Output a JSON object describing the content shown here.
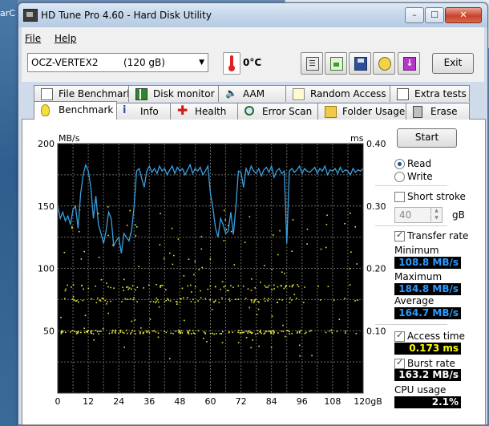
{
  "desktop": {
    "left_text": "arC"
  },
  "window": {
    "title": "HD Tune Pro 4.60 - Hard Disk Utility",
    "controls": {
      "minimize": "–",
      "maximize": "☐",
      "close": "✕"
    }
  },
  "menu": {
    "file": "File",
    "help": "Help"
  },
  "toolbar": {
    "drive_name": "OCZ-VERTEX2",
    "drive_size": "(120 gB)",
    "temperature": "0°C",
    "exit_label": "Exit",
    "icons": [
      "copy-text-icon",
      "copy-screenshot-icon",
      "save-icon",
      "options-icon",
      "download-icon"
    ]
  },
  "tabs_top": [
    {
      "label": "File Benchmark",
      "icon": "file-benchmark-icon"
    },
    {
      "label": "Disk monitor",
      "icon": "disk-monitor-icon"
    },
    {
      "label": "AAM",
      "icon": "speaker-icon"
    },
    {
      "label": "Random Access",
      "icon": "random-access-icon"
    },
    {
      "label": "Extra tests",
      "icon": "extra-tests-icon"
    }
  ],
  "tabs_bottom": [
    {
      "label": "Benchmark",
      "icon": "bulb-icon",
      "active": true
    },
    {
      "label": "Info",
      "icon": "info-icon"
    },
    {
      "label": "Health",
      "icon": "health-cross-icon"
    },
    {
      "label": "Error Scan",
      "icon": "magnifier-icon"
    },
    {
      "label": "Folder Usage",
      "icon": "folder-icon"
    },
    {
      "label": "Erase",
      "icon": "trash-icon"
    }
  ],
  "chart_data": {
    "type": "line",
    "y_left_label": "MB/s",
    "y_right_label": "ms",
    "y_left_ticks": [
      "200",
      "150",
      "100",
      "50"
    ],
    "y_right_ticks": [
      "0.40",
      "0.30",
      "0.20",
      "0.10"
    ],
    "x_ticks": [
      "0",
      "12",
      "24",
      "36",
      "48",
      "60",
      "72",
      "84",
      "96",
      "108",
      "120gB"
    ],
    "ylim_left": [
      0,
      200
    ],
    "ylim_right": [
      0,
      0.4
    ],
    "xlim": [
      0,
      120
    ],
    "grid": true,
    "series": [
      {
        "color": "#3aa0e0",
        "x": [
          0,
          1,
          2,
          3,
          4,
          5,
          6,
          7,
          8,
          9,
          10,
          11,
          12,
          13,
          14,
          15,
          16,
          17,
          18,
          19,
          20,
          21,
          22,
          23,
          24,
          25,
          26,
          27,
          28,
          29,
          30,
          31,
          32,
          33,
          34,
          35,
          36,
          37,
          38,
          39,
          40,
          41,
          42,
          43,
          44,
          45,
          46,
          47,
          48,
          49,
          50,
          51,
          52,
          53,
          54,
          55,
          56,
          57,
          58,
          59,
          60,
          61,
          62,
          63,
          64,
          65,
          66,
          67,
          68,
          69,
          70,
          71,
          72,
          73,
          74,
          75,
          76,
          77,
          78,
          79,
          80,
          81,
          82,
          83,
          84,
          85,
          86,
          87,
          88,
          89,
          90,
          91,
          92,
          93,
          94,
          95,
          96,
          97,
          98,
          99,
          100,
          101,
          102,
          103,
          104,
          105,
          106,
          107,
          108,
          109,
          110,
          111,
          112,
          113,
          114,
          115,
          116,
          117,
          118,
          119,
          120
        ],
        "values": [
          150,
          140,
          145,
          138,
          142,
          135,
          147,
          150,
          132,
          160,
          175,
          183,
          178,
          165,
          140,
          158,
          135,
          128,
          120,
          130,
          145,
          140,
          118,
          122,
          125,
          112,
          128,
          125,
          122,
          130,
          150,
          178,
          180,
          172,
          165,
          178,
          182,
          177,
          180,
          176,
          182,
          178,
          180,
          175,
          179,
          182,
          176,
          181,
          178,
          180,
          175,
          179,
          183,
          176,
          180,
          178,
          181,
          175,
          178,
          182,
          160,
          148,
          132,
          125,
          140,
          135,
          128,
          130,
          145,
          127,
          150,
          178,
          177,
          165,
          180,
          175,
          182,
          178,
          176,
          180,
          174,
          179,
          181,
          177,
          182,
          173,
          178,
          180,
          176,
          178,
          120,
          178,
          180,
          177,
          179,
          182,
          176,
          180,
          178,
          177,
          179,
          181,
          176,
          180,
          178,
          182,
          175,
          179,
          178,
          180,
          176,
          181,
          177,
          179,
          178,
          175,
          180,
          177,
          179,
          178,
          180
        ]
      }
    ]
  },
  "controls": {
    "start_label": "Start",
    "read_label": "Read",
    "write_label": "Write",
    "short_stroke_label": "Short stroke",
    "short_stroke_value": "40",
    "short_stroke_unit": "gB",
    "transfer_rate_label": "Transfer rate",
    "minimum_label": "Minimum",
    "minimum_value": "108.8 MB/s",
    "maximum_label": "Maximum",
    "maximum_value": "184.8 MB/s",
    "average_label": "Average",
    "average_value": "164.7 MB/s",
    "access_time_label": "Access time",
    "access_time_value": "0.173 ms",
    "burst_rate_label": "Burst rate",
    "burst_rate_value": "163.2 MB/s",
    "cpu_usage_label": "CPU usage",
    "cpu_usage_value": "2.1%"
  }
}
